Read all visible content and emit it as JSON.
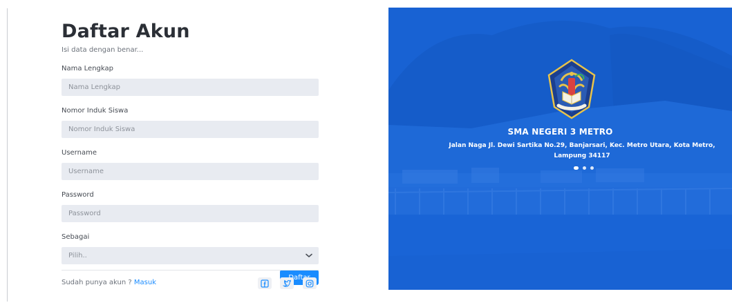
{
  "form": {
    "title": "Daftar Akun",
    "subtitle": "Isi data dengan benar...",
    "fields": [
      {
        "label": "Nama Lengkap",
        "placeholder": "Nama Lengkap",
        "value": ""
      },
      {
        "label": "Nomor Induk Siswa",
        "placeholder": "Nomor Induk Siswa",
        "value": ""
      },
      {
        "label": "Username",
        "placeholder": "Username",
        "value": ""
      },
      {
        "label": "Password",
        "placeholder": "Password",
        "value": ""
      }
    ],
    "role": {
      "label": "Sebagai",
      "selected": "Pilih.."
    },
    "submit_label": "Daftar",
    "footer_prompt": "Sudah punya akun ?",
    "login_link": "Masuk",
    "social_icons": [
      "facebook-icon",
      "twitter-icon",
      "instagram-icon"
    ]
  },
  "hero": {
    "school_name": "SMA NEGERI 3 METRO",
    "address": "Jalan Naga Jl. Dewi Sartika No.29, Banjarsari, Kec. Metro Utara, Kota Metro, Lampung 34117",
    "carousel_count": 3,
    "carousel_active": 1
  },
  "colors": {
    "accent": "#1a8cff",
    "input_bg": "#e8ebf1",
    "hero_overlay": "#1464e1"
  }
}
